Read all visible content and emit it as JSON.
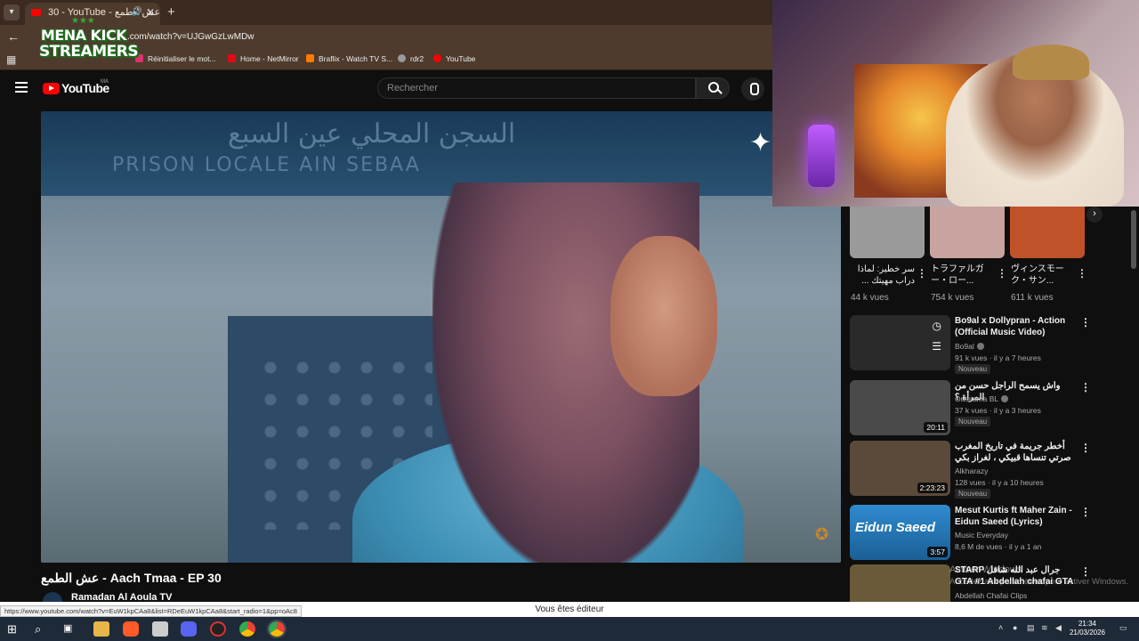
{
  "browser": {
    "tab_title": "30 - YouTube - عش الطمع",
    "url": ".com/watch?v=UJGwGzLwMDw",
    "bookmarks": [
      {
        "label": "Réinitialiser le mot...",
        "color": "#e1306c"
      },
      {
        "label": "Home - NetMirror",
        "color": "#e50914"
      },
      {
        "label": "Braflix - Watch TV S...",
        "color": "#ff7a00"
      },
      {
        "label": "rdr2",
        "color": "#9a9a9a"
      },
      {
        "label": "YouTube",
        "color": "#ff0000"
      }
    ]
  },
  "overlay_logo": {
    "line1": "MENA KICK",
    "line2": "STREAMERS"
  },
  "youtube": {
    "logo_text": "YouTube",
    "country_code": "MA",
    "search_placeholder": "Rechercher"
  },
  "video": {
    "title": "عش الطمع - Aach Tmaa - EP 30",
    "channel": "Ramadan Al Aoula TV",
    "sign_arabic": "السجن المحلي عين السبع",
    "sign_french": "PRISON LOCALE AIN SEBAA"
  },
  "shorts": [
    {
      "title": "سر خطير: لماذا دراب مهيتك ...",
      "views": "44 k vues",
      "color": "#9a9a9a"
    },
    {
      "title": "トラファルガー・ロー...",
      "views": "754 k vues",
      "color": "#c9a3a0"
    },
    {
      "title": "ヴィンスモーク・サン...",
      "views": "611 k vues",
      "color": "#c0522a"
    }
  ],
  "recommendations": [
    {
      "title": "Bo9al x Dollypran - Action (Official Music Video)",
      "channel": "Bo9al",
      "meta": "91 k vues · il y a 7 heures",
      "badge": "Nouveau",
      "duration": "",
      "thumb": "#2a2a2a"
    },
    {
      "title": "واش يسمح الراجل حسن من المرأة ؟",
      "channel": "Oussama BL",
      "meta": "37 k vues · il y a 3 heures",
      "badge": "Nouveau",
      "duration": "20:11",
      "thumb": "#4a4a4a"
    },
    {
      "title": "أخطر جريمة في تاريخ المغرب صرتي تنساها قبيكي ، لغراز بكي",
      "channel": "Alkharazy",
      "meta": "128 vues · il y a 10 heures",
      "badge": "Nouveau",
      "duration": "2:23:23",
      "thumb": "#5a4a3a"
    },
    {
      "title": "Mesut Kurtis  ft Maher Zain - Eidun Saeed (Lyrics)",
      "channel": "Music Everyday",
      "meta": "8,6 M de vues · il y a 1 an",
      "badge": "",
      "duration": "3:57",
      "thumb": "#1b6aa8",
      "thumb_text": "Eidun Saeed"
    },
    {
      "title": "STARP جرال عبد الله شافل GTA #1 Abdellah chafai GTA",
      "channel": "Abdellah Chafai Clips",
      "meta": "",
      "badge": "",
      "duration": "",
      "thumb": "#6b5a3a"
    }
  ],
  "status": {
    "hover_url": "https://www.youtube.com/watch?v=EuW1kpCAa8&list=RDeEuW1kpCAa8&start_radio=1&pp=oAc8",
    "editor_notice": "Vous êtes éditeur"
  },
  "windows_watermark": {
    "line1": "Activer Windows",
    "line2": "Accédez aux paramètres pour activer Windows."
  },
  "taskbar": {
    "time": "21:34",
    "date": "21/03/2026"
  }
}
